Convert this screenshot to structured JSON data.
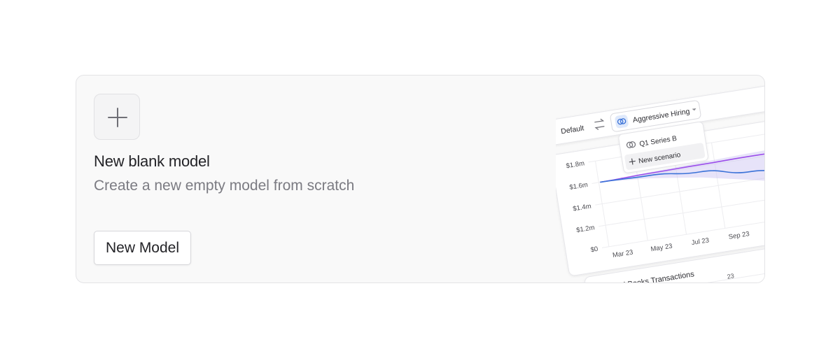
{
  "card": {
    "title": "New blank model",
    "description": "Create a new empty model from scratch",
    "button_label": "New Model"
  },
  "illustration": {
    "scenario_bar": {
      "default_label": "Default",
      "selected_scenario": "Aggressive Hiring",
      "swap_icon": "swap-arrows-icon",
      "chevron_icon": "chevron-down-icon"
    },
    "dropdown": {
      "items": [
        {
          "label": "Q1 Series B",
          "icon": "scenario-icon"
        },
        {
          "label": "New scenario",
          "icon": "plus-icon"
        }
      ]
    },
    "table_title": "QuickBooks Transactions",
    "table_partial_value": "23"
  },
  "chart_data": {
    "type": "line",
    "title": "",
    "xlabel": "",
    "ylabel": "",
    "y_tick_labels": [
      "$1.8m",
      "$1.6m",
      "$1.4m",
      "$1.2m",
      "$0"
    ],
    "x_tick_labels": [
      "Mar 23",
      "May 23",
      "Jul 23",
      "Sep 23"
    ],
    "series": [
      {
        "color": "#9b4dea",
        "values": [
          1.6,
          1.61,
          1.615,
          1.62,
          1.62
        ]
      },
      {
        "color": "#3a72d8",
        "values": [
          1.6,
          1.59,
          1.55,
          1.48,
          1.4
        ]
      }
    ],
    "colors": {
      "band": "#c9c2f2"
    }
  }
}
